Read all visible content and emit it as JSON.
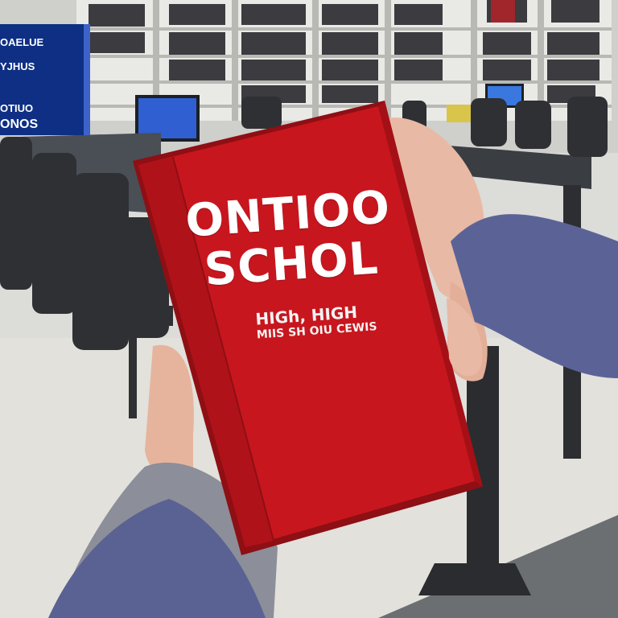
{
  "book": {
    "title_lines": [
      "ONTIOO",
      "SCHOL"
    ],
    "subtitle_line1": "HIGh, HIGH",
    "subtitle_line2": "MIIS SH OIU CEWIS",
    "cover_color": "#c8161e"
  },
  "sign": {
    "lines": [
      "OAELUE",
      "YJHUS",
      "OTIUO",
      "ONOS"
    ],
    "color": "#0e2f83"
  },
  "scene": {
    "description_colors": {
      "floor": "#d9d9d6",
      "sleeve": "#5b6396",
      "table": "#3a3d42"
    }
  }
}
